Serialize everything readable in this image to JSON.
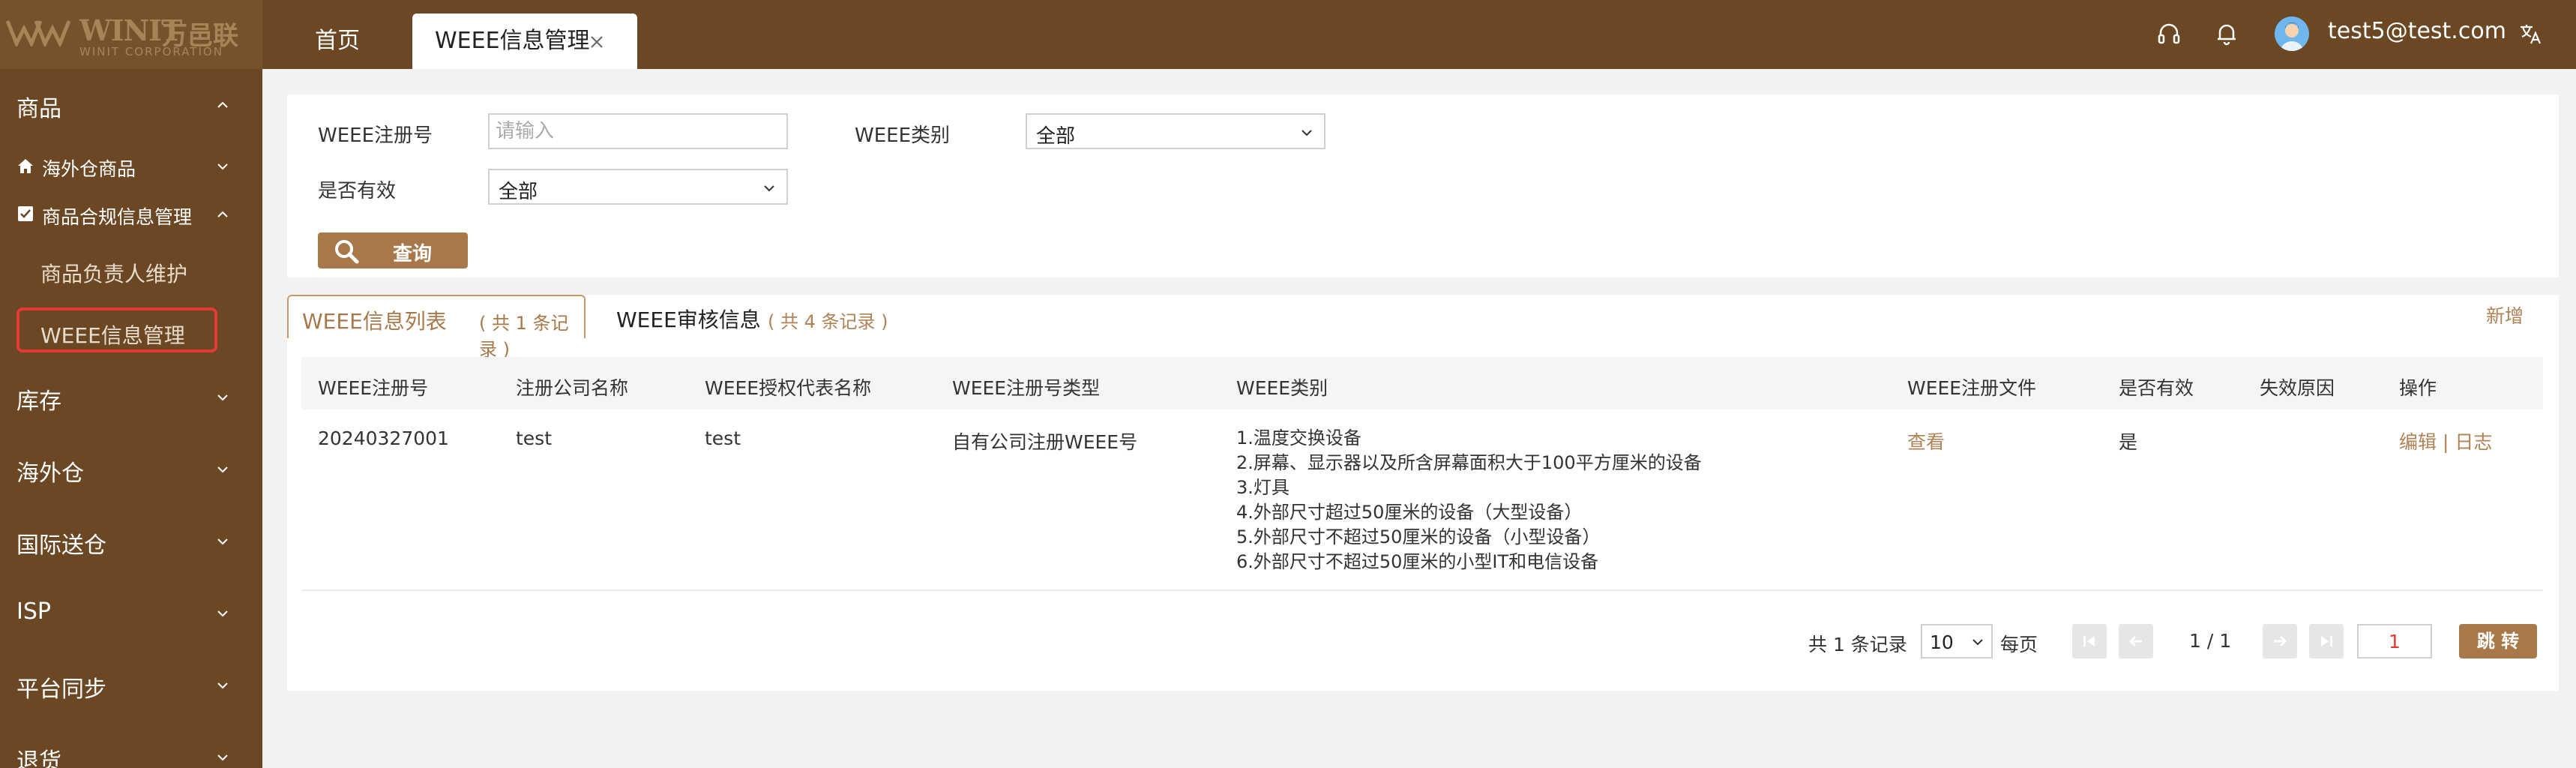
{
  "brand": {
    "name": "WINIT",
    "name_cn": "万邑联",
    "subtitle": "WINIT CORPORATION"
  },
  "header": {
    "tabs": [
      {
        "label": "首页"
      },
      {
        "label": "WEEE信息管理"
      }
    ],
    "user_email": "test5@test.com",
    "icons": [
      "headset-icon",
      "bell-icon",
      "avatar",
      "translate-icon"
    ]
  },
  "sidebar": {
    "groups": [
      {
        "label": "商品",
        "expanded": true
      },
      {
        "label": "库存"
      },
      {
        "label": "海外仓"
      },
      {
        "label": "国际送仓"
      },
      {
        "label": "ISP"
      },
      {
        "label": "平台同步"
      },
      {
        "label": "退货"
      }
    ],
    "subgroups": [
      {
        "label": "海外仓商品",
        "icon": "home-icon"
      },
      {
        "label": "商品合规信息管理",
        "icon": "checkbox-icon",
        "expanded": true
      }
    ],
    "leaves": [
      {
        "label": "商品负责人维护"
      },
      {
        "label": "WEEE信息管理",
        "selected": true
      }
    ]
  },
  "filters": {
    "reg_no_label": "WEEE注册号",
    "reg_no_placeholder": "请输入",
    "category_label": "WEEE类别",
    "category_value": "全部",
    "valid_label": "是否有效",
    "valid_value": "全部",
    "query_label": "查询"
  },
  "list": {
    "tab1_label": "WEEE信息列表",
    "tab1_count": "( 共 1 条记录 )",
    "tab2_label": "WEEE审核信息",
    "tab2_count": "( 共 4 条记录 )",
    "add_label": "新增",
    "columns": [
      "WEEE注册号",
      "注册公司名称",
      "WEEE授权代表名称",
      "WEEE注册号类型",
      "WEEE类别",
      "WEEE注册文件",
      "是否有效",
      "失效原因",
      "操作"
    ],
    "rows": [
      {
        "reg_no": "20240327001",
        "company": "test",
        "agent": "test",
        "reg_type": "自有公司注册WEEE号",
        "categories": [
          "1.温度交换设备",
          "2.屏幕、显示器以及所含屏幕面积大于100平方厘米的设备",
          "3.灯具",
          "4.外部尺寸超过50厘米的设备（大型设备）",
          "5.外部尺寸不超过50厘米的设备（小型设备）",
          "6.外部尺寸不超过50厘米的小型IT和电信设备"
        ],
        "file_link": "查看",
        "valid": "是",
        "invalid_reason": "",
        "action_edit": "编辑",
        "action_sep": "|",
        "action_log": "日志"
      }
    ]
  },
  "pagination": {
    "total_text": "共 1 条记录",
    "page_size": "10",
    "per_page_text": "每页",
    "page_count_text": "1 / 1",
    "page_input": "1",
    "jump_label": "跳 转"
  },
  "colors": {
    "header_bg": "#6b4723",
    "accent": "#a9784a",
    "link": "#b08255",
    "highlight_border": "#e53935"
  }
}
